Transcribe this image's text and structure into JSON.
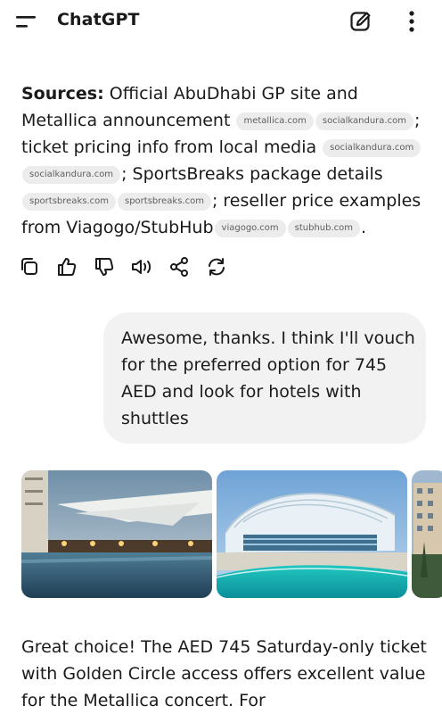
{
  "header": {
    "title": "ChatGPT",
    "menu_icon": "menu-icon",
    "new_chat_icon": "edit-icon",
    "more_icon": "more-vertical-icon"
  },
  "sources": {
    "label": "Sources:",
    "part1": " Official AbuDhabi GP site and Metallica announcement",
    "part2": "; ticket pricing info from local media",
    "part3": "; SportsBreaks package details",
    "part4": "; reseller price examples from Viagogo/StubHub",
    "part5": ".",
    "chips": [
      "metallica.com",
      "socialkandura.com",
      "socialkandura.com",
      "socialkandura.com",
      "sportsbreaks.com",
      "sportsbreaks.com",
      "viagogo.com",
      "stubhub.com"
    ]
  },
  "actions": [
    "copy-icon",
    "thumbs-up-icon",
    "thumbs-down-icon",
    "read-aloud-icon",
    "share-icon",
    "regenerate-icon"
  ],
  "user_message": "Awesome, thanks. I think I'll vouch for the preferred option for 745 AED and look for hotels with shuttles",
  "images": [
    "hotel-pool-image",
    "yas-viceroy-hotel-image",
    "hotel-building-image"
  ],
  "reply": "Great choice!  The AED 745 Saturday-only ticket with Golden Circle access offers excellent value for the Metallica concert.  For"
}
